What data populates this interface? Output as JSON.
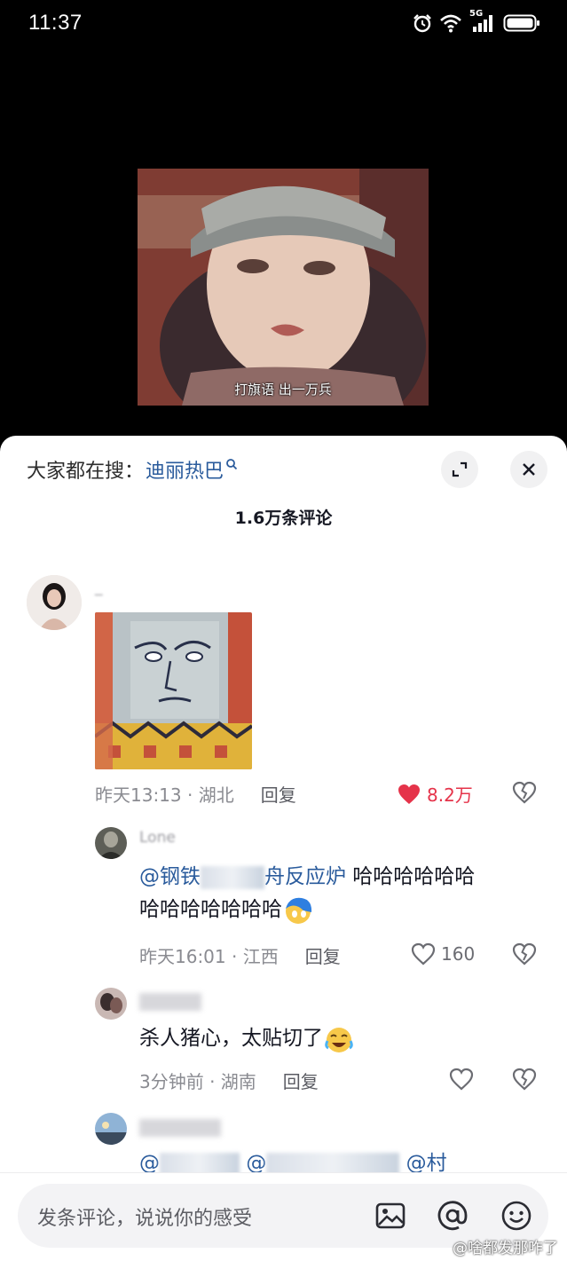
{
  "status_bar": {
    "time": "11:37",
    "network": "5G"
  },
  "video": {
    "subtitle": "打旗语 出一万兵"
  },
  "sheet": {
    "search_prefix": "大家都在搜：",
    "search_term": "迪丽热巴",
    "comment_count": "1.6万条评论"
  },
  "comments": [
    {
      "username": "_",
      "time_location": "昨天13:13 · 湖北",
      "reply_label": "回复",
      "likes": "8.2万",
      "liked": true
    },
    {
      "username": "Lone",
      "mention_a": "@钢铁",
      "mention_b": "舟反应炉",
      "text_line1": " 哈哈哈哈哈哈",
      "text_line2": "哈哈哈哈哈哈哈",
      "time_location": "昨天16:01 · 江西",
      "reply_label": "回复",
      "likes": "160"
    },
    {
      "username": "",
      "text": "杀人猪心，太贴切了",
      "time_location": "3分钟前 · 湖南",
      "reply_label": "回复"
    },
    {
      "username": "",
      "mention_a": "@",
      "mention_b": "@",
      "mention_c": "@村"
    }
  ],
  "input_bar": {
    "placeholder": "发条评论，说说你的感受"
  },
  "watermark": "@啥都发那咋了",
  "icons": {
    "status": [
      "alarm-icon",
      "wifi-icon",
      "signal-icon",
      "battery-icon"
    ],
    "sheet": [
      "search-icon",
      "expand-icon",
      "close-icon",
      "heart-icon",
      "dislike-icon"
    ],
    "input": [
      "image-icon",
      "mention-icon",
      "emoji-icon"
    ]
  },
  "colors": {
    "accent_link": "#2a5b9c",
    "like_red": "#e5334a",
    "sheet_bg": "#ffffff"
  }
}
